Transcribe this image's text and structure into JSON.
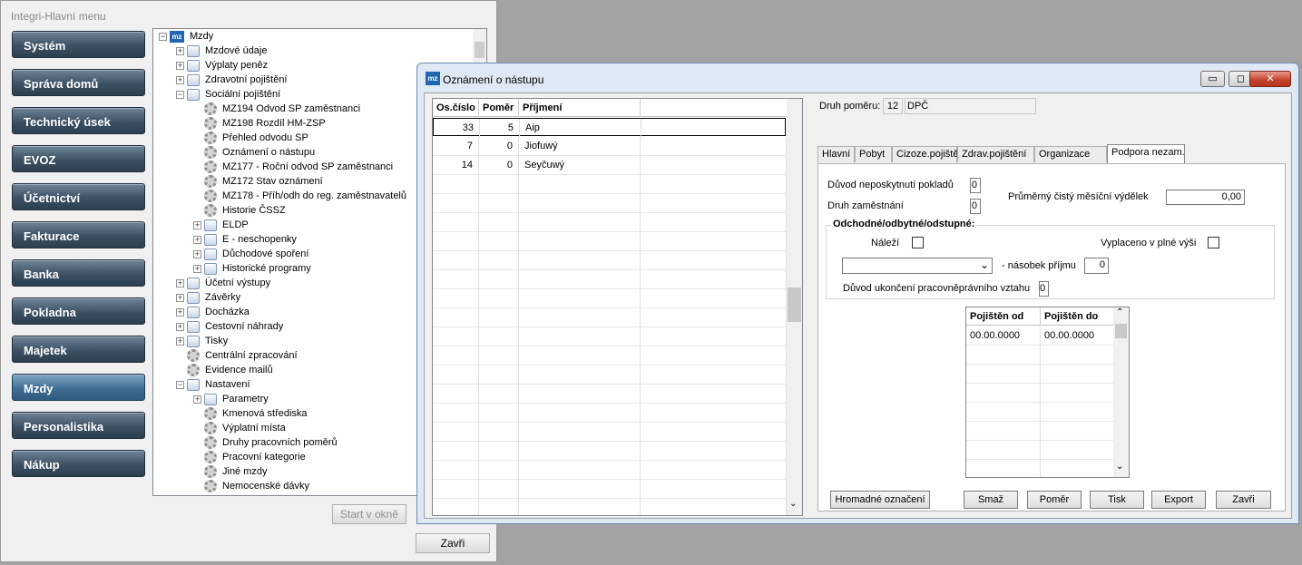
{
  "main": {
    "title": "Integri-Hlavní menu",
    "nav": [
      "Systém",
      "Správa domů",
      "Technický úsek",
      "EVOZ",
      "Účetnictví",
      "Fakturace",
      "Banka",
      "Pokladna",
      "Majetek",
      "Mzdy",
      "Personalistika",
      "Nákup"
    ],
    "active_nav": "Mzdy",
    "tree": [
      {
        "label": "Mzdy",
        "icon": "mz-icon",
        "toggle": "−"
      },
      {
        "label": "Mzdové údaje",
        "icon": "folder-icon",
        "toggle": "+"
      },
      {
        "label": "Výplaty peněz",
        "icon": "folder-icon",
        "toggle": "+"
      },
      {
        "label": "Zdravotní pojištění",
        "icon": "folder-icon",
        "toggle": "+"
      },
      {
        "label": "Sociální pojištění",
        "icon": "folder-icon",
        "toggle": "−"
      },
      {
        "label": "MZ194 Odvod SP zaměstnanci",
        "icon": "gear-icon",
        "toggle": ""
      },
      {
        "label": "MZ198 Rozdíl HM-ZSP",
        "icon": "gear-icon",
        "toggle": ""
      },
      {
        "label": "Přehled odvodu SP",
        "icon": "gear-icon",
        "toggle": ""
      },
      {
        "label": "Oznámení o nástupu",
        "icon": "gear-icon",
        "toggle": ""
      },
      {
        "label": "MZ177 - Roční odvod SP zaměstnanci",
        "icon": "gear-icon",
        "toggle": ""
      },
      {
        "label": "MZ172 Stav oznámení",
        "icon": "gear-icon",
        "toggle": ""
      },
      {
        "label": "MZ178 - Příh/odh do reg. zaměstnavatelů",
        "icon": "gear-icon",
        "toggle": ""
      },
      {
        "label": "Historie ČSSZ",
        "icon": "gear-icon",
        "toggle": ""
      },
      {
        "label": "ELDP",
        "icon": "folder-icon",
        "toggle": "+"
      },
      {
        "label": "E - neschopenky",
        "icon": "folder-icon",
        "toggle": "+"
      },
      {
        "label": "Důchodové spoření",
        "icon": "folder-icon",
        "toggle": "+"
      },
      {
        "label": "Historické programy",
        "icon": "folder-icon",
        "toggle": "+"
      },
      {
        "label": "Účetní výstupy",
        "icon": "folder-icon",
        "toggle": "+"
      },
      {
        "label": "Závěrky",
        "icon": "folder-icon",
        "toggle": "+"
      },
      {
        "label": "Docházka",
        "icon": "folder-icon",
        "toggle": "+"
      },
      {
        "label": "Cestovní náhrady",
        "icon": "folder-icon",
        "toggle": "+"
      },
      {
        "label": "Tisky",
        "icon": "folder-icon",
        "toggle": "+"
      },
      {
        "label": "Centrální zpracování",
        "icon": "gear-icon",
        "toggle": ""
      },
      {
        "label": "Evidence mailů",
        "icon": "gear-icon",
        "toggle": ""
      },
      {
        "label": "Nastavení",
        "icon": "folder-icon",
        "toggle": "−"
      },
      {
        "label": "Parametry",
        "icon": "folder-icon",
        "toggle": "+"
      },
      {
        "label": "Kmenová střediska",
        "icon": "gear-icon",
        "toggle": ""
      },
      {
        "label": "Výplatní místa",
        "icon": "gear-icon",
        "toggle": ""
      },
      {
        "label": "Druhy pracovních poměrů",
        "icon": "gear-icon",
        "toggle": ""
      },
      {
        "label": "Pracovní kategorie",
        "icon": "gear-icon",
        "toggle": ""
      },
      {
        "label": "Jiné mzdy",
        "icon": "gear-icon",
        "toggle": ""
      },
      {
        "label": "Nemocenské dávky",
        "icon": "gear-icon",
        "toggle": ""
      }
    ],
    "start_label": "Start v okně",
    "close_label": "Zavři"
  },
  "dialog": {
    "title": "Oznámení o nástupu",
    "columns": [
      "Os.číslo",
      "Poměr",
      "Příjmení"
    ],
    "rows": [
      {
        "os": "33",
        "pomer": "5",
        "prijmeni": "Aip"
      },
      {
        "os": "7",
        "pomer": "0",
        "prijmeni": "Jiofuwý"
      },
      {
        "os": "14",
        "pomer": "0",
        "prijmeni": "Seyčuwý"
      }
    ],
    "druh_pomeru_label": "Druh poměru:",
    "druh_pomeru_code": "12",
    "druh_pomeru_name": "DPČ",
    "tabs": [
      "Hlavní",
      "Pobyt",
      "Cizoze.pojištění",
      "Zdrav.pojištění",
      "Organizace",
      "Podpora nezam."
    ],
    "active_tab": "Podpora nezam.",
    "duvod_label": "Důvod neposkytnutí pokladů",
    "duvod_value": "0",
    "druh_zam_label": "Druh zaměstnání",
    "druh_zam_value": "0",
    "prumer_label": "Průměrný čistý měsíční výdělek",
    "prumer_value": "0,00",
    "group_label": "Odchodné/odbytné/odstupné:",
    "nalezi_label": "Náleží",
    "vyplaceno_label": "Vyplaceno v plné výši",
    "nasobek_label": "- násobek příjmu",
    "nasobek_value": "0",
    "ukonceni_label": "Důvod ukončení pracovněprávního vztahu",
    "ukonceni_value": "0",
    "pojisten_cols": [
      "Pojištěn od",
      "Pojištěn do"
    ],
    "pojisten_row": [
      "00.00.0000",
      "00.00.0000"
    ],
    "buttons": {
      "hromadne": "Hromadné označení",
      "smaz": "Smaž",
      "pomer": "Poměr",
      "tisk": "Tisk",
      "export": "Export",
      "zavri": "Zavři"
    }
  }
}
